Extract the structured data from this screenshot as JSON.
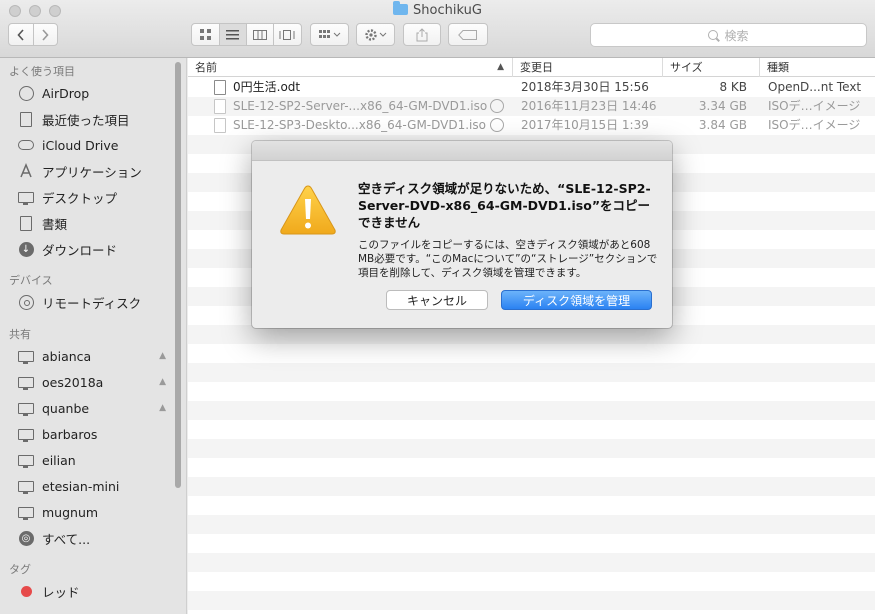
{
  "window": {
    "title": "ShochikuG"
  },
  "toolbar": {
    "search_placeholder": "検索",
    "back_icon": "chevron-left-icon",
    "forward_icon": "chevron-right-icon",
    "view_icons": [
      "icon-view-icon",
      "list-view-icon",
      "column-view-icon",
      "cover-flow-icon"
    ],
    "arrange_icon": "arrange-icon",
    "action_icon": "gear-icon",
    "share_icon": "share-icon",
    "tag_icon": "tag-icon"
  },
  "sidebar": {
    "favorites_header": "よく使う項目",
    "favorites": [
      {
        "label": "AirDrop",
        "icon": "airdrop-icon"
      },
      {
        "label": "最近使った項目",
        "icon": "recents-icon"
      },
      {
        "label": "iCloud Drive",
        "icon": "cloud-icon"
      },
      {
        "label": "アプリケーション",
        "icon": "applications-icon"
      },
      {
        "label": "デスクトップ",
        "icon": "desktop-icon"
      },
      {
        "label": "書類",
        "icon": "documents-icon"
      },
      {
        "label": "ダウンロード",
        "icon": "downloads-icon"
      }
    ],
    "devices_header": "デバイス",
    "devices": [
      {
        "label": "リモートディスク",
        "icon": "disc-icon"
      }
    ],
    "shared_header": "共有",
    "shared": [
      {
        "label": "abianca",
        "icon": "computer-icon",
        "eject": "▲"
      },
      {
        "label": "oes2018a",
        "icon": "computer-icon",
        "eject": "▲"
      },
      {
        "label": "quanbe",
        "icon": "computer-icon",
        "eject": "▲"
      },
      {
        "label": "barbaros",
        "icon": "computer-icon"
      },
      {
        "label": "eilian",
        "icon": "computer-icon"
      },
      {
        "label": "etesian-mini",
        "icon": "computer-icon"
      },
      {
        "label": "mugnum",
        "icon": "computer-icon"
      },
      {
        "label": "すべて...",
        "icon": "globe-icon"
      }
    ],
    "tags_header": "タグ",
    "tags": [
      {
        "label": "レッド",
        "color": "#e64a4a"
      }
    ]
  },
  "list": {
    "columns": {
      "name": "名前",
      "modified": "変更日",
      "size": "サイズ",
      "kind": "種類"
    },
    "files": [
      {
        "name": "0円生活.odt",
        "modified": "2018年3月30日 15:56",
        "size": "8 KB",
        "kind": "OpenD...nt Text",
        "dim": false
      },
      {
        "name": "SLE-12-SP2-Server-...x86_64-GM-DVD1.iso",
        "modified": "2016年11月23日 14:46",
        "size": "3.34 GB",
        "kind": "ISOデ…イメージ",
        "dim": true
      },
      {
        "name": "SLE-12-SP3-Deskto...x86_64-GM-DVD1.iso",
        "modified": "2017年10月15日 1:39",
        "size": "3.84 GB",
        "kind": "ISOデ…イメージ",
        "dim": true
      }
    ]
  },
  "dialog": {
    "icon": "warning-icon",
    "title": "空きディスク領域が足りないため、“SLE-12-SP2-Server-DVD-x86_64-GM-DVD1.iso”をコピーできません",
    "message": "このファイルをコピーするには、空きディスク領域があと608 MB必要です。“このMacについて”の“ストレージ”セクションで項目を削除して、ディスク領域を管理できます。",
    "cancel_label": "キャンセル",
    "primary_label": "ディスク領域を管理"
  }
}
